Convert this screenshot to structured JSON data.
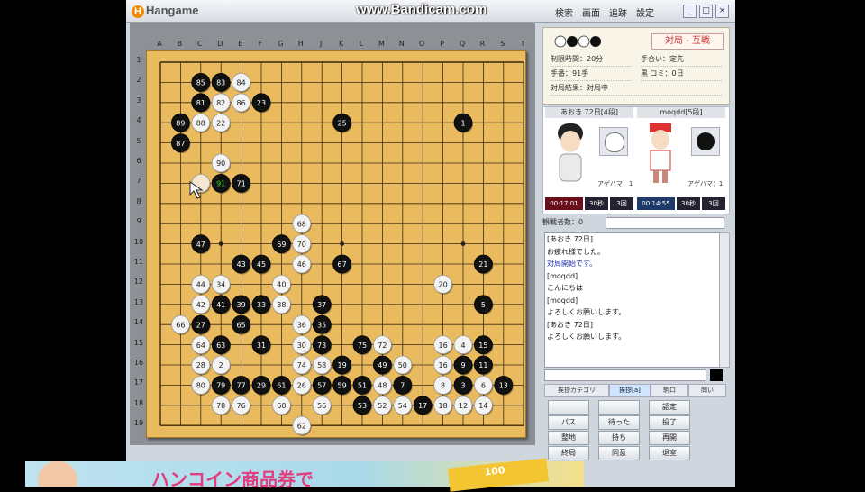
{
  "titlebar": {
    "logo": "Hangame",
    "watermark": "www.Bandicam.com",
    "menu": [
      "検索",
      "画面",
      "追跡",
      "設定"
    ],
    "controls": [
      "_",
      "□",
      "×"
    ]
  },
  "board": {
    "columns": [
      "A",
      "B",
      "C",
      "D",
      "E",
      "F",
      "G",
      "H",
      "J",
      "K",
      "L",
      "M",
      "N",
      "O",
      "P",
      "Q",
      "R",
      "S",
      "T"
    ],
    "rows": [
      "1",
      "2",
      "3",
      "4",
      "5",
      "6",
      "7",
      "8",
      "9",
      "10",
      "11",
      "12",
      "13",
      "14",
      "15",
      "16",
      "17",
      "18",
      "19"
    ],
    "star_points": [
      [
        3,
        3
      ],
      [
        3,
        9
      ],
      [
        3,
        15
      ],
      [
        9,
        3
      ],
      [
        9,
        9
      ],
      [
        9,
        15
      ],
      [
        15,
        3
      ],
      [
        15,
        9
      ],
      [
        15,
        15
      ]
    ],
    "stones": [
      {
        "c": 2,
        "r": 1,
        "color": "B",
        "n": "85"
      },
      {
        "c": 3,
        "r": 1,
        "color": "B",
        "n": "83"
      },
      {
        "c": 4,
        "r": 1,
        "color": "W",
        "n": "84"
      },
      {
        "c": 2,
        "r": 2,
        "color": "B",
        "n": "81"
      },
      {
        "c": 3,
        "r": 2,
        "color": "W",
        "n": "82"
      },
      {
        "c": 4,
        "r": 2,
        "color": "W",
        "n": "86"
      },
      {
        "c": 5,
        "r": 2,
        "color": "B",
        "n": "23"
      },
      {
        "c": 1,
        "r": 3,
        "color": "B",
        "n": "89"
      },
      {
        "c": 2,
        "r": 3,
        "color": "W",
        "n": "88"
      },
      {
        "c": 3,
        "r": 3,
        "color": "W",
        "n": "22"
      },
      {
        "c": 1,
        "r": 4,
        "color": "B",
        "n": "87"
      },
      {
        "c": 3,
        "r": 5,
        "color": "W",
        "n": "90"
      },
      {
        "c": 2,
        "r": 6,
        "color": "W",
        "n": ""
      },
      {
        "c": 3,
        "r": 6,
        "color": "B",
        "n": "91",
        "last": true
      },
      {
        "c": 4,
        "r": 6,
        "color": "B",
        "n": "71"
      },
      {
        "c": 9,
        "r": 3,
        "color": "B",
        "n": "25"
      },
      {
        "c": 15,
        "r": 3,
        "color": "B",
        "n": "1"
      },
      {
        "c": 7,
        "r": 8,
        "color": "W",
        "n": "68"
      },
      {
        "c": 2,
        "r": 9,
        "color": "B",
        "n": "47"
      },
      {
        "c": 6,
        "r": 9,
        "color": "B",
        "n": "69"
      },
      {
        "c": 7,
        "r": 9,
        "color": "W",
        "n": "70"
      },
      {
        "c": 4,
        "r": 10,
        "color": "B",
        "n": "43"
      },
      {
        "c": 5,
        "r": 10,
        "color": "B",
        "n": "45"
      },
      {
        "c": 7,
        "r": 10,
        "color": "W",
        "n": "46"
      },
      {
        "c": 9,
        "r": 10,
        "color": "B",
        "n": "67"
      },
      {
        "c": 16,
        "r": 10,
        "color": "B",
        "n": "21"
      },
      {
        "c": 2,
        "r": 11,
        "color": "W",
        "n": "44"
      },
      {
        "c": 3,
        "r": 11,
        "color": "W",
        "n": "34"
      },
      {
        "c": 6,
        "r": 11,
        "color": "W",
        "n": "40"
      },
      {
        "c": 14,
        "r": 11,
        "color": "W",
        "n": "20"
      },
      {
        "c": 2,
        "r": 12,
        "color": "W",
        "n": "42"
      },
      {
        "c": 3,
        "r": 12,
        "color": "B",
        "n": "41"
      },
      {
        "c": 4,
        "r": 12,
        "color": "B",
        "n": "39"
      },
      {
        "c": 5,
        "r": 12,
        "color": "B",
        "n": "33"
      },
      {
        "c": 6,
        "r": 12,
        "color": "W",
        "n": "38"
      },
      {
        "c": 8,
        "r": 12,
        "color": "B",
        "n": "37"
      },
      {
        "c": 16,
        "r": 12,
        "color": "B",
        "n": "5"
      },
      {
        "c": 1,
        "r": 13,
        "color": "W",
        "n": "66"
      },
      {
        "c": 2,
        "r": 13,
        "color": "B",
        "n": "27"
      },
      {
        "c": 4,
        "r": 13,
        "color": "B",
        "n": "65"
      },
      {
        "c": 7,
        "r": 13,
        "color": "W",
        "n": "36"
      },
      {
        "c": 8,
        "r": 13,
        "color": "B",
        "n": "35"
      },
      {
        "c": 2,
        "r": 14,
        "color": "W",
        "n": "64"
      },
      {
        "c": 3,
        "r": 14,
        "color": "B",
        "n": "63"
      },
      {
        "c": 5,
        "r": 14,
        "color": "B",
        "n": "31"
      },
      {
        "c": 7,
        "r": 14,
        "color": "W",
        "n": "30"
      },
      {
        "c": 8,
        "r": 14,
        "color": "B",
        "n": "73"
      },
      {
        "c": 10,
        "r": 14,
        "color": "B",
        "n": "75"
      },
      {
        "c": 11,
        "r": 14,
        "color": "W",
        "n": "72"
      },
      {
        "c": 14,
        "r": 14,
        "color": "W",
        "n": "16"
      },
      {
        "c": 15,
        "r": 14,
        "color": "W",
        "n": "4"
      },
      {
        "c": 16,
        "r": 14,
        "color": "B",
        "n": "15"
      },
      {
        "c": 2,
        "r": 15,
        "color": "W",
        "n": "28"
      },
      {
        "c": 3,
        "r": 15,
        "color": "W",
        "n": "2"
      },
      {
        "c": 7,
        "r": 15,
        "color": "W",
        "n": "74"
      },
      {
        "c": 8,
        "r": 15,
        "color": "W",
        "n": "58"
      },
      {
        "c": 9,
        "r": 15,
        "color": "B",
        "n": "19"
      },
      {
        "c": 11,
        "r": 15,
        "color": "B",
        "n": "49"
      },
      {
        "c": 12,
        "r": 15,
        "color": "W",
        "n": "50"
      },
      {
        "c": 14,
        "r": 15,
        "color": "W",
        "n": "16"
      },
      {
        "c": 15,
        "r": 15,
        "color": "B",
        "n": "9"
      },
      {
        "c": 16,
        "r": 15,
        "color": "B",
        "n": "11"
      },
      {
        "c": 2,
        "r": 16,
        "color": "W",
        "n": "80"
      },
      {
        "c": 3,
        "r": 16,
        "color": "B",
        "n": "79"
      },
      {
        "c": 4,
        "r": 16,
        "color": "B",
        "n": "77"
      },
      {
        "c": 5,
        "r": 16,
        "color": "B",
        "n": "29"
      },
      {
        "c": 6,
        "r": 16,
        "color": "B",
        "n": "61"
      },
      {
        "c": 7,
        "r": 16,
        "color": "W",
        "n": "26"
      },
      {
        "c": 8,
        "r": 16,
        "color": "B",
        "n": "57"
      },
      {
        "c": 9,
        "r": 16,
        "color": "B",
        "n": "59"
      },
      {
        "c": 10,
        "r": 16,
        "color": "B",
        "n": "51"
      },
      {
        "c": 11,
        "r": 16,
        "color": "W",
        "n": "48"
      },
      {
        "c": 12,
        "r": 16,
        "color": "B",
        "n": "7"
      },
      {
        "c": 14,
        "r": 16,
        "color": "W",
        "n": "8"
      },
      {
        "c": 15,
        "r": 16,
        "color": "B",
        "n": "3"
      },
      {
        "c": 16,
        "r": 16,
        "color": "W",
        "n": "6"
      },
      {
        "c": 17,
        "r": 16,
        "color": "B",
        "n": "13"
      },
      {
        "c": 3,
        "r": 17,
        "color": "W",
        "n": "78"
      },
      {
        "c": 4,
        "r": 17,
        "color": "W",
        "n": "76"
      },
      {
        "c": 6,
        "r": 17,
        "color": "W",
        "n": "60"
      },
      {
        "c": 8,
        "r": 17,
        "color": "W",
        "n": "56"
      },
      {
        "c": 10,
        "r": 17,
        "color": "B",
        "n": "53"
      },
      {
        "c": 11,
        "r": 17,
        "color": "W",
        "n": "52"
      },
      {
        "c": 12,
        "r": 17,
        "color": "W",
        "n": "54"
      },
      {
        "c": 13,
        "r": 17,
        "color": "B",
        "n": "17"
      },
      {
        "c": 14,
        "r": 17,
        "color": "W",
        "n": "18"
      },
      {
        "c": 15,
        "r": 17,
        "color": "W",
        "n": "12"
      },
      {
        "c": 16,
        "r": 17,
        "color": "W",
        "n": "14"
      },
      {
        "c": 7,
        "r": 18,
        "color": "W",
        "n": "62"
      }
    ]
  },
  "side": {
    "title": "対局 ‐ 互戦",
    "info": [
      {
        "label": "制限時間：20分"
      },
      {
        "label": "手合い：定先"
      },
      {
        "label": "手番：91手"
      },
      {
        "label": "黒 コミ：0日"
      },
      {
        "label": "対局結果：対局中"
      }
    ],
    "player_black": "あおき 72日[4段]",
    "player_white": "moqdd[5段]",
    "agehama_left": "アゲハマ：1",
    "agehama_right": "アゲハマ：1",
    "clock_left": [
      "00:17:01",
      "30秒",
      "3回"
    ],
    "clock_right": [
      "00:14:55",
      "30秒",
      "3回"
    ],
    "spectators": "観戦者数：0",
    "chat": [
      {
        "t": "[あおき 72日]",
        "c": ""
      },
      {
        "t": "お疲れ様でした。",
        "c": ""
      },
      {
        "t": "対局開始です。",
        "c": "blue"
      },
      {
        "t": "[moqdd]",
        "c": ""
      },
      {
        "t": "こんにちは",
        "c": ""
      },
      {
        "t": "[moqdd]",
        "c": ""
      },
      {
        "t": "よろしくお願いします。",
        "c": ""
      },
      {
        "t": "[あおき 72日]",
        "c": ""
      },
      {
        "t": "よろしくお願いします。",
        "c": ""
      }
    ],
    "tabs": [
      "挨拶カテゴリ",
      "挨拶[a]",
      "駒口",
      "問い"
    ],
    "buttons": [
      [
        "",
        "",
        "認定"
      ],
      [
        "パス",
        "待った",
        "投了"
      ],
      [
        "整地",
        "持ち",
        "再開"
      ],
      [
        "終局",
        "同意",
        "退室"
      ]
    ]
  },
  "ad": {
    "text": "ハンコイン商品券で",
    "coupon": "100"
  }
}
